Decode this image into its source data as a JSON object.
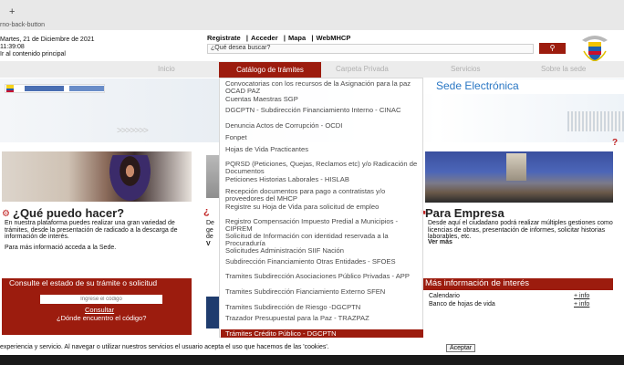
{
  "topbar": {
    "plus": "+",
    "back_button": "rno-back-button"
  },
  "header": {
    "date_line1": "Martes, 21 de Diciembre de 2021",
    "date_line2": "11:39:08",
    "skip_link": "Ir al contenido principal",
    "register": "Registrate",
    "access": "Acceder",
    "map": "Mapa",
    "webmail": "WebMHCP",
    "search_placeholder": "¿Qué desea buscar?",
    "search_icon": "search-icon",
    "accent": "#9c1c0e"
  },
  "nav": {
    "items": [
      "Inicio",
      "Catálogo de trámites",
      "Carpeta Privada",
      "Servicios",
      "Sobre la sede"
    ]
  },
  "hero": {
    "title": "Sede Electrónica"
  },
  "sections": {
    "que": {
      "title": "¿Qué puedo hacer?",
      "desc": "En nuestra plataforma puedes realizar una gran variedad de trámites, desde la presentación de radicado a la descarga de información de interés.",
      "more": "Para más informació acceda a la Sede."
    },
    "mid": {
      "title": "¿",
      "line1": "De",
      "line2": "ge",
      "line3": "de",
      "line4": "V"
    },
    "empresa": {
      "title": "Para Empresa",
      "desc": "Desde aquí el ciudadano podrá realizar múltiples gestiones como licencias de obras, presentación de informes, solicitar historias laborables, etc.",
      "more": "Ver más"
    }
  },
  "consult": {
    "title": "Consulte el estado de su trámite o solicitud",
    "placeholder": "Ingrese el código",
    "button": "Consultar",
    "where": "¿Dónde encuentro el código?"
  },
  "info": {
    "title": "Más información de interés",
    "rows": [
      {
        "label": "Calendario",
        "link": "+ info"
      },
      {
        "label": "Banco de hojas de vida",
        "link": "+ info"
      }
    ]
  },
  "cookie": {
    "text": "experiencia y servicio. Al navegar o utilizar nuestros servicios el usuario acepta el uso que hacemos de las 'cookies'.",
    "button": "Aceptar"
  },
  "dropdown": {
    "items": [
      "Convocatorias con los recursos de la Asignación para la paz OCAD PAZ",
      "Cuentas Maestras SGP",
      "DGCPTN - Subdirección Financiamiento Interno - CINAC",
      "Denuncia Actos de Corrupción - OCDI",
      "Fonpet",
      "Hojas de Vida Practicantes",
      "PQRSD (Peticiones, Quejas, Reclamos etc) y/o Radicación de Documentos",
      "Peticiones Historias Laborales - HISLAB",
      "Recepción documentos para pago a contratistas y/o proveedores del MHCP",
      "Registre su Hoja de Vida para solicitud de empleo",
      "Registro Compensación Impuesto Predial a Municipios - CIPREM",
      "Solicitud de Información con identidad reservada a la Procuraduría",
      "Solicitudes Administración SIIF Nación",
      "Subdirección Financiamiento Otras Entidades - SFOES",
      "Tramites Subdirección Asociaciones Público Privadas - APP",
      "Tramites Subdirección Fianciamiento Externo SFEN",
      "Tramites Subdirección de Riesgo -DGCPTN",
      "Trazador Presupuestal para la Paz - TRAZPAZ"
    ],
    "selected": "Trámites Crédito Público - DGCPTN"
  }
}
